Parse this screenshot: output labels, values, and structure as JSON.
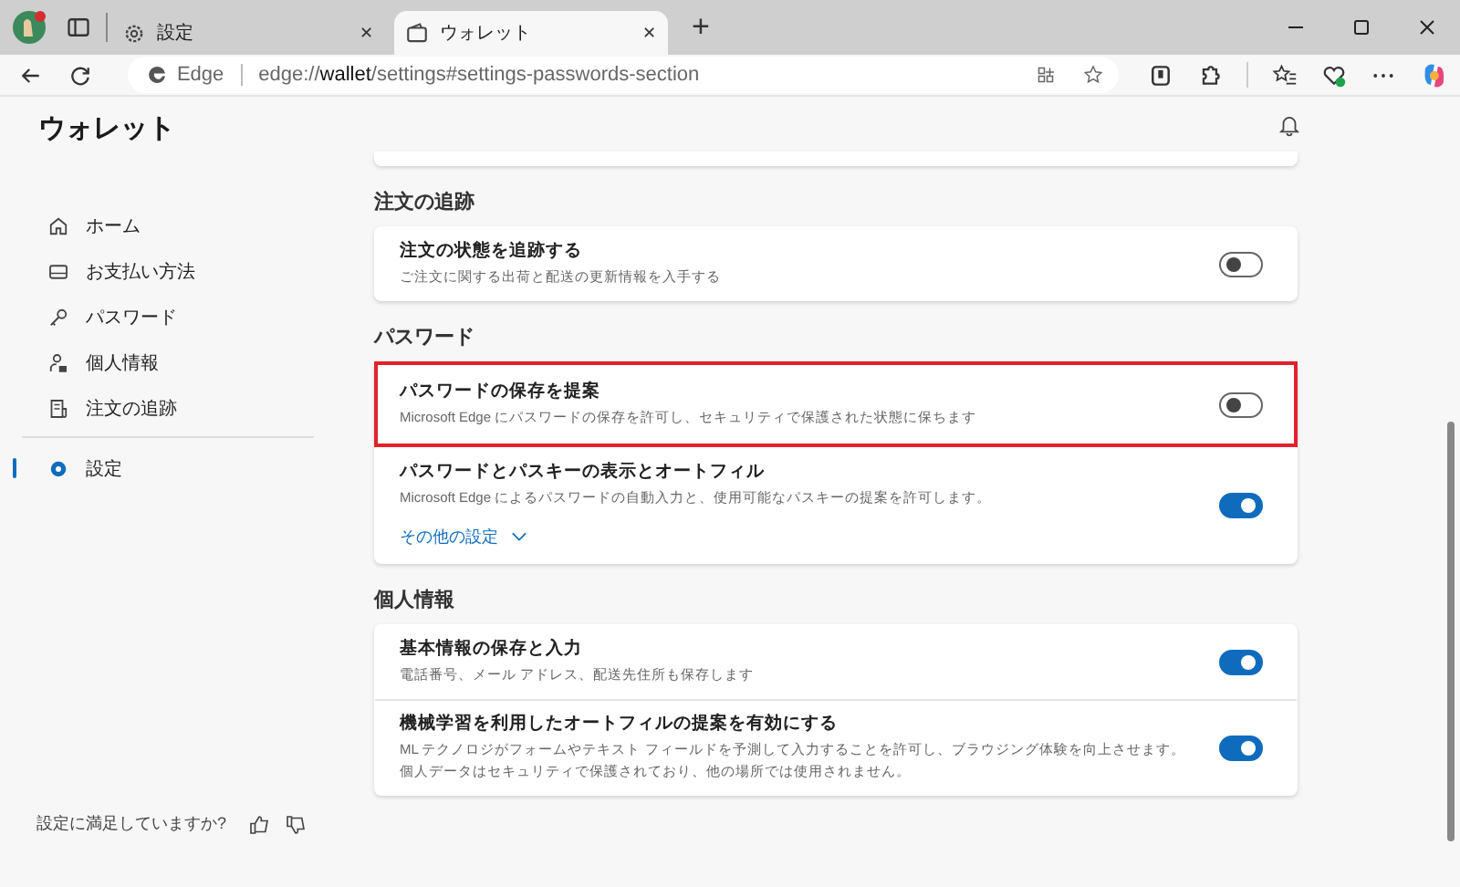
{
  "browser_tabs": [
    {
      "title": "設定",
      "close": "✕",
      "selected": false
    },
    {
      "title": "ウォレット",
      "close": "✕",
      "selected": true
    }
  ],
  "new_tab": "+",
  "address_bar": {
    "site": "Edge",
    "url": "edge://**wallet**/settings#settings-passwords-section"
  },
  "sidebar": {
    "title": "ウォレット",
    "items": [
      {
        "label": "ホーム",
        "selected": false
      },
      {
        "label": "お支払い方法",
        "selected": false
      },
      {
        "label": "パスワード",
        "selected": false
      },
      {
        "label": "個人情報",
        "selected": false
      },
      {
        "label": "注文の追跡",
        "selected": false
      },
      {
        "label": "設定",
        "selected": true
      }
    ],
    "feedback": "設定に満足していますか?"
  },
  "sections": [
    {
      "heading": "注文の追跡",
      "rows": [
        {
          "kind": "toggle",
          "title": "注文の状態を追跡する",
          "description": "ご注文に関する出荷と配送の更新情報を入手する",
          "on": false,
          "highlighted": false
        }
      ]
    },
    {
      "heading": "パスワード",
      "rows": [
        {
          "kind": "toggle",
          "title": "パスワードの保存を提案",
          "description": "Microsoft Edge にパスワードの保存を許可し、セキュリティで保護された状態に保ちます",
          "on": false,
          "highlighted": true
        },
        {
          "kind": "toggle",
          "title": "パスワードとパスキーの表示とオートフィル",
          "description": "Microsoft Edge によるパスワードの自動入力と、使用可能なパスキーの提案を許可します。",
          "on": true,
          "highlighted": false,
          "link": "その他の設定"
        }
      ]
    },
    {
      "heading": "個人情報",
      "rows": [
        {
          "kind": "toggle",
          "title": "基本情報の保存と入力",
          "description": "電話番号、メール アドレス、配送先住所も保存します",
          "on": true,
          "highlighted": false
        },
        {
          "kind": "toggle",
          "title": "機械学習を利用したオートフィルの提案を有効にする",
          "description": "ML テクノロジがフォームやテキスト フィールドを予測して入力することを許可し、ブラウジング体験を向上させます。個人データはセキュリティで保護されており、他の場所では使用されません。",
          "on": true,
          "highlighted": false
        }
      ]
    }
  ]
}
